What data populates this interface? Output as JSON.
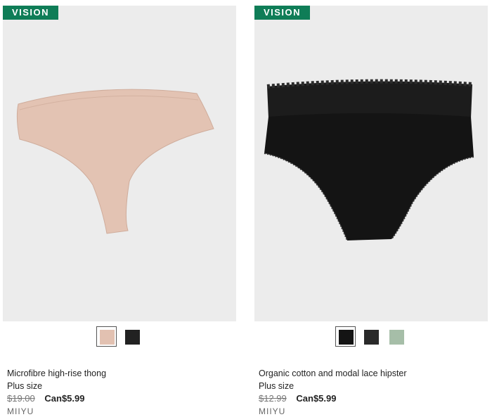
{
  "products": [
    {
      "badge": "VISION",
      "title": "Microfibre high-rise thong",
      "size": "Plus size",
      "old_price": "$19.00",
      "new_price": "Can$5.99",
      "brand": "MIIYU",
      "swatches": [
        {
          "name": "blush",
          "color": "#e2c1b1",
          "selected": true
        },
        {
          "name": "black",
          "color": "#222222",
          "selected": false
        }
      ]
    },
    {
      "badge": "VISION",
      "title": "Organic cotton and modal lace hipster",
      "size": "Plus size",
      "old_price": "$12.99",
      "new_price": "Can$5.99",
      "brand": "MIIYU",
      "swatches": [
        {
          "name": "black",
          "color": "#141414",
          "selected": true
        },
        {
          "name": "floral-print",
          "color": "#2a2a2a",
          "selected": false
        },
        {
          "name": "sage",
          "color": "#a6bea8",
          "selected": false
        }
      ]
    }
  ],
  "colors": {
    "badge_bg": "#0f7d57",
    "image_bg": "#ececec"
  }
}
